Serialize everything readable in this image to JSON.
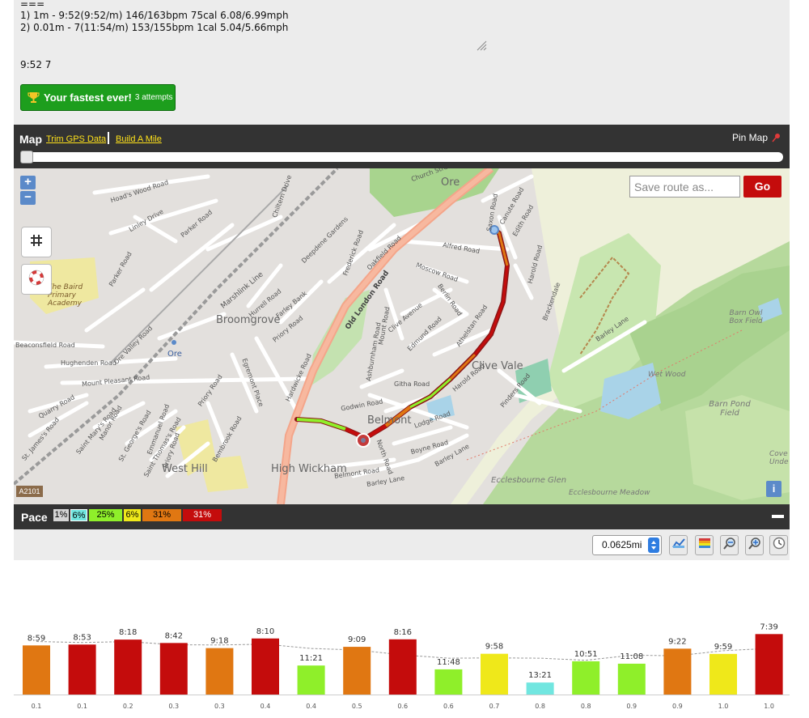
{
  "summary": {
    "separator": "===",
    "splits": [
      "1) 1m - 9:52(9:52/m) 146/163bpm 75cal 6.08/6.99mph",
      "2) 0.01m - 7(11:54/m) 153/155bpm 1cal 5.04/5.66mph"
    ],
    "result_line": "9:52 7"
  },
  "badge": {
    "text": "Your fastest ever!",
    "attempts": "3 attempts",
    "icon": "trophy-icon"
  },
  "map_header": {
    "title": "Map",
    "trim_link": "Trim GPS Data",
    "build_link": "Build A Mile",
    "pin_label": "Pin Map",
    "trim_start": 0
  },
  "map": {
    "zoom_in": "+",
    "zoom_out": "−",
    "save_placeholder": "Save route as...",
    "go_label": "Go",
    "info_label": "i",
    "road_shield": "A2101",
    "labels": {
      "ore_top": "Ore",
      "broomgrove": "Broomgrove",
      "ore_station": "Ore",
      "clive_vale": "Clive Vale",
      "belmont": "Belmont",
      "high_wickham": "High Wickham",
      "west_hill": "West Hill",
      "ecclesbourne_glen": "Ecclesbourne Glen",
      "ecclesbourne_meadow": "Ecclesbourne Meadow",
      "barn_owl": "Barn Owl Box Field",
      "barn_pond": "Barn Pond Field",
      "wet_wood": "Wet Wood",
      "cove": "Cove Unde",
      "baird": "The Baird Primary Academy",
      "hoads_wood": "Hoad's Wood Road",
      "linley": "Linley Drive",
      "parker_top": "Parker Road",
      "chiltern": "Chiltern Drive",
      "deepdene": "Deepdene Gardens",
      "frederick": "Frederick Road",
      "oakfield": "Oakfield Road",
      "old_london": "Old London Road",
      "alfred": "Alfred Road",
      "moscow": "Moscow Road",
      "berlin": "Berlin Road",
      "saxon": "Saxon Road",
      "canute": "Canute Road",
      "edith": "Edith Road",
      "harold_rd": "Harold Road",
      "bracken": "Brackendale",
      "barley_lane_e": "Barley Lane",
      "marshlink": "Marshlink Line",
      "hurrell": "Hurrell Road",
      "farley": "Farley Bank",
      "priory_top": "Priory Road",
      "clive_ave": "Clive Avenue",
      "mount_rd": "Mount Road",
      "edmund": "Edmund Road",
      "athelstan": "Athelstan Road",
      "ashburnham": "Ashburnham Road",
      "harold_pl": "Harold Road",
      "githa": "Githa Road",
      "godwin": "Godwin Road",
      "lodge": "Lodge Road",
      "boyne": "Boyne Road",
      "barley_lane_s": "Barley Lane",
      "belmont_rd": "Belmont Road",
      "barley_lane_w": "Barley Lane",
      "north_rd": "North Road",
      "pinders": "Pinders Road",
      "beaconsfield": "Beaconsfield Road",
      "hughenden": "Hughenden Road",
      "ore_valley": "Ore Valley Road",
      "mount_pleasant": "Mount Pleasant Road",
      "hardwicke": "Hardwicke Road",
      "egremont": "Egremont Place",
      "priory_mid": "Priory Road",
      "quarry": "Quarry Road",
      "st_james": "St. James's Road",
      "st_marys": "Saint Mary's Road",
      "manor": "Manor Road",
      "st_georges": "St. George's Road",
      "emmanuel": "Emmanuel Road",
      "st_thomas": "Saint Thomas's Road",
      "priory_low": "Priory Road",
      "bembrook": "Bembrook Road",
      "parker_left": "Parker Road",
      "church_st": "Church Street"
    }
  },
  "pace": {
    "title": "Pace",
    "zones": [
      {
        "label": "1%",
        "color": "#d4d4d4"
      },
      {
        "label": "6%",
        "color": "#71e6e0"
      },
      {
        "label": "25%",
        "color": "#8fef2a"
      },
      {
        "label": "6%",
        "color": "#efe81a"
      },
      {
        "label": "31%",
        "color": "#e07712"
      },
      {
        "label": "31%",
        "color": "#c40c0c"
      }
    ]
  },
  "toolbar": {
    "split_value": "0.0625mi",
    "buttons": [
      "chart-icon",
      "color-scale-icon",
      "zoom-out-icon",
      "zoom-in-icon",
      "clock-icon"
    ]
  },
  "colors": {
    "red": "#c40c0c",
    "orange": "#e07712",
    "green": "#8fef2a",
    "yellow": "#efe81a",
    "cyan": "#71e6e0",
    "route_blue": "#5b8ac9"
  },
  "chart_data": {
    "type": "bar",
    "title": "",
    "xlabel": "",
    "ylabel": "",
    "unit": "min/mile pace",
    "categories": [
      "0.1",
      "0.1",
      "0.2",
      "0.3",
      "0.3",
      "0.4",
      "0.4",
      "0.5",
      "0.6",
      "0.6",
      "0.7",
      "0.8",
      "0.8",
      "0.9",
      "0.9",
      "1.0",
      "1.0"
    ],
    "values": [
      "8:59",
      "8:53",
      "8:18",
      "8:42",
      "9:18",
      "8:10",
      "11:21",
      "9:09",
      "8:16",
      "11:48",
      "9:58",
      "13:21",
      "10:51",
      "11:08",
      "9:22",
      "9:59",
      "7:39"
    ],
    "values_seconds": [
      539,
      533,
      498,
      522,
      558,
      490,
      681,
      549,
      496,
      708,
      598,
      801,
      651,
      668,
      562,
      599,
      459
    ],
    "bar_colors": [
      "#e07712",
      "#c40c0c",
      "#c40c0c",
      "#c40c0c",
      "#e07712",
      "#c40c0c",
      "#8fef2a",
      "#e07712",
      "#c40c0c",
      "#8fef2a",
      "#efe81a",
      "#71e6e0",
      "#8fef2a",
      "#8fef2a",
      "#e07712",
      "#efe81a",
      "#c40c0c"
    ],
    "trend_line": "dashed average line",
    "grid": false,
    "legend": "none"
  }
}
